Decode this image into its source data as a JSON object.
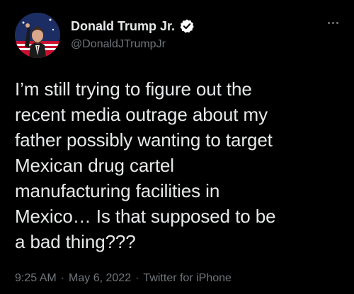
{
  "author": {
    "display_name": "Donald Trump Jr.",
    "handle": "@DonaldJTrumpJr",
    "verified": true,
    "avatar": "profile-photo"
  },
  "tweet": {
    "text": "I’m still trying to figure out the\nrecent media outrage about my\nfather possibly wanting to target\nMexican drug cartel\nmanufacturing facilities in\nMexico… Is that supposed to be\na bad thing???"
  },
  "meta": {
    "time": "9:25 AM",
    "separator": "·",
    "date": "May 6, 2022",
    "source": "Twitter for iPhone"
  },
  "icons": {
    "verified": "verified-badge-icon",
    "more": "more-options-icon"
  },
  "colors": {
    "background": "#000000",
    "text_primary": "#e7e9ea",
    "text_secondary": "#71767b",
    "verified_badge": "#ffffff"
  }
}
